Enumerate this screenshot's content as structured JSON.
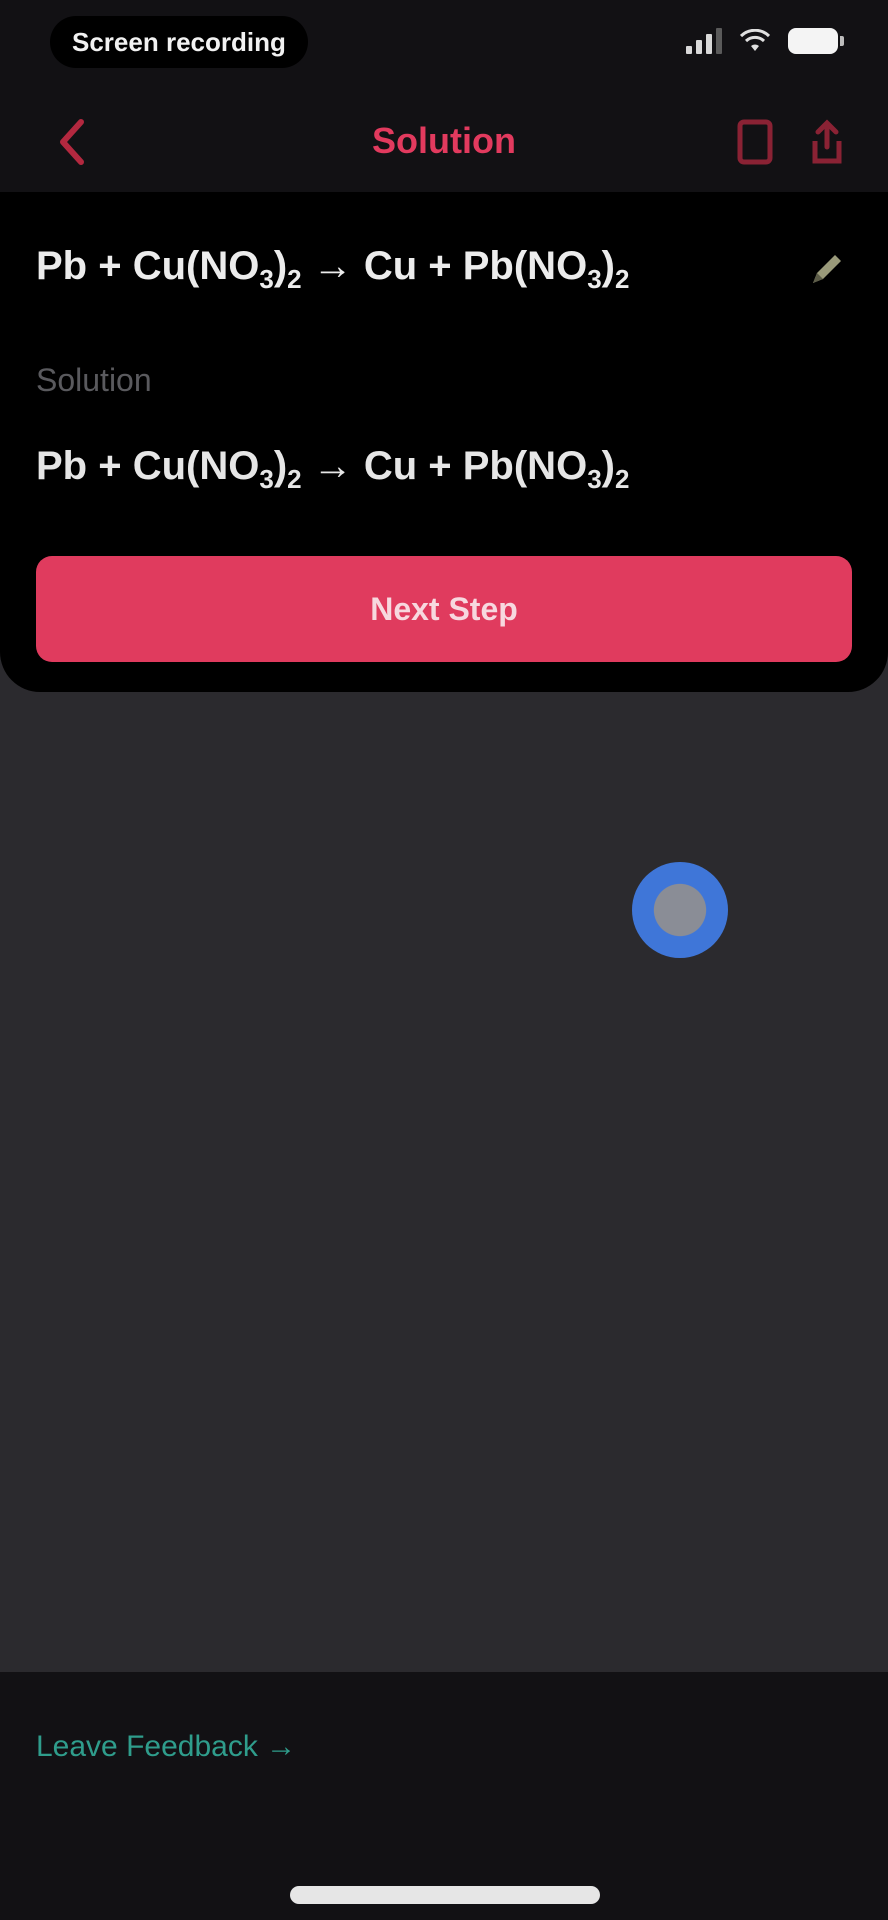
{
  "status_bar": {
    "carrier_text": "Screen recording",
    "signal_bars": 3
  },
  "nav": {
    "title": "Solution"
  },
  "card": {
    "equation": {
      "parts": [
        "Pb + Cu(NO",
        "3",
        ")",
        "2",
        " → Cu + Pb(NO",
        "3",
        ")",
        "2"
      ]
    },
    "solution_label": "Solution",
    "solution_equation": {
      "parts": [
        "Pb + Cu(NO",
        "3",
        ")",
        "2",
        " → Cu + Pb(NO",
        "3",
        ")",
        "2"
      ]
    },
    "primary_button_label": "Next Step"
  },
  "footer": {
    "feedback_link": "Leave Feedback →"
  },
  "colors": {
    "accent": "#e03b5e",
    "link": "#2f9d8c",
    "background": "#2b2a2e",
    "bar_background": "#121114"
  }
}
